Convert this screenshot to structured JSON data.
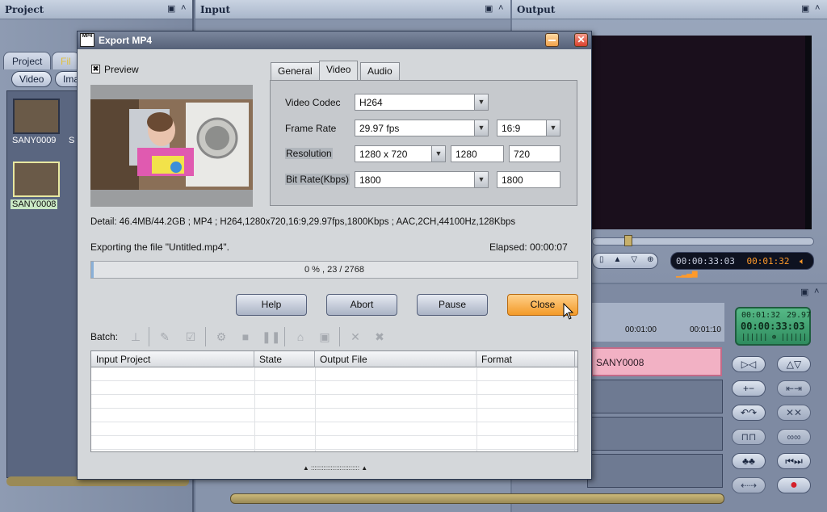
{
  "app": {
    "project_panel": {
      "title": "Project",
      "tabs": [
        "Project",
        "Fil"
      ],
      "filters": [
        "Video",
        "Ima"
      ],
      "thumbs": [
        "SANY0009",
        "S",
        "SANY0008"
      ]
    },
    "input_panel": {
      "title": "Input"
    },
    "output_panel": {
      "title": "Output"
    },
    "timecode": {
      "current": "00:00:33:03",
      "duration": "00:01:32"
    },
    "lcd": {
      "line1_left": "00:01:32",
      "line1_right": "29.97",
      "main": "00:00:33:03"
    },
    "ruler": [
      "00:01:00",
      "00:01:10"
    ],
    "clip_label": "SANY0008"
  },
  "dialog": {
    "title": "Export MP4",
    "icon_text": "MP4",
    "preview_label": "Preview",
    "tabs": [
      "General",
      "Video",
      "Audio"
    ],
    "active_tab": "Video",
    "video_codec": {
      "label": "Video Codec",
      "value": "H264"
    },
    "frame_rate": {
      "label": "Frame Rate",
      "value": "29.97 fps",
      "aspect": "16:9"
    },
    "resolution": {
      "label": "Resolution",
      "value": "1280 x 720",
      "width": "1280",
      "height": "720"
    },
    "bit_rate": {
      "label": "Bit Rate(Kbps)",
      "value": "1800",
      "custom": "1800"
    },
    "detail": "Detail: 46.4MB/44.2GB  ;  MP4  ;  H264,1280x720,16:9,29.97fps,1800Kbps  ;  AAC,2CH,44100Hz,128Kbps",
    "status": "Exporting the file \"Untitled.mp4\".",
    "elapsed": "Elapsed: 00:00:07",
    "progress": {
      "text": "0 % ,   23 / 2768",
      "fraction": 0.0
    },
    "buttons": {
      "help": "Help",
      "abort": "Abort",
      "pause": "Pause",
      "close": "Close"
    },
    "batch_label": "Batch:",
    "grid_columns": [
      "Input Project",
      "State",
      "Output File",
      "Format"
    ]
  },
  "colors": {
    "accent_close": "#f39a28",
    "clip": "#f2b1c4",
    "lcd": "#3fa070"
  }
}
